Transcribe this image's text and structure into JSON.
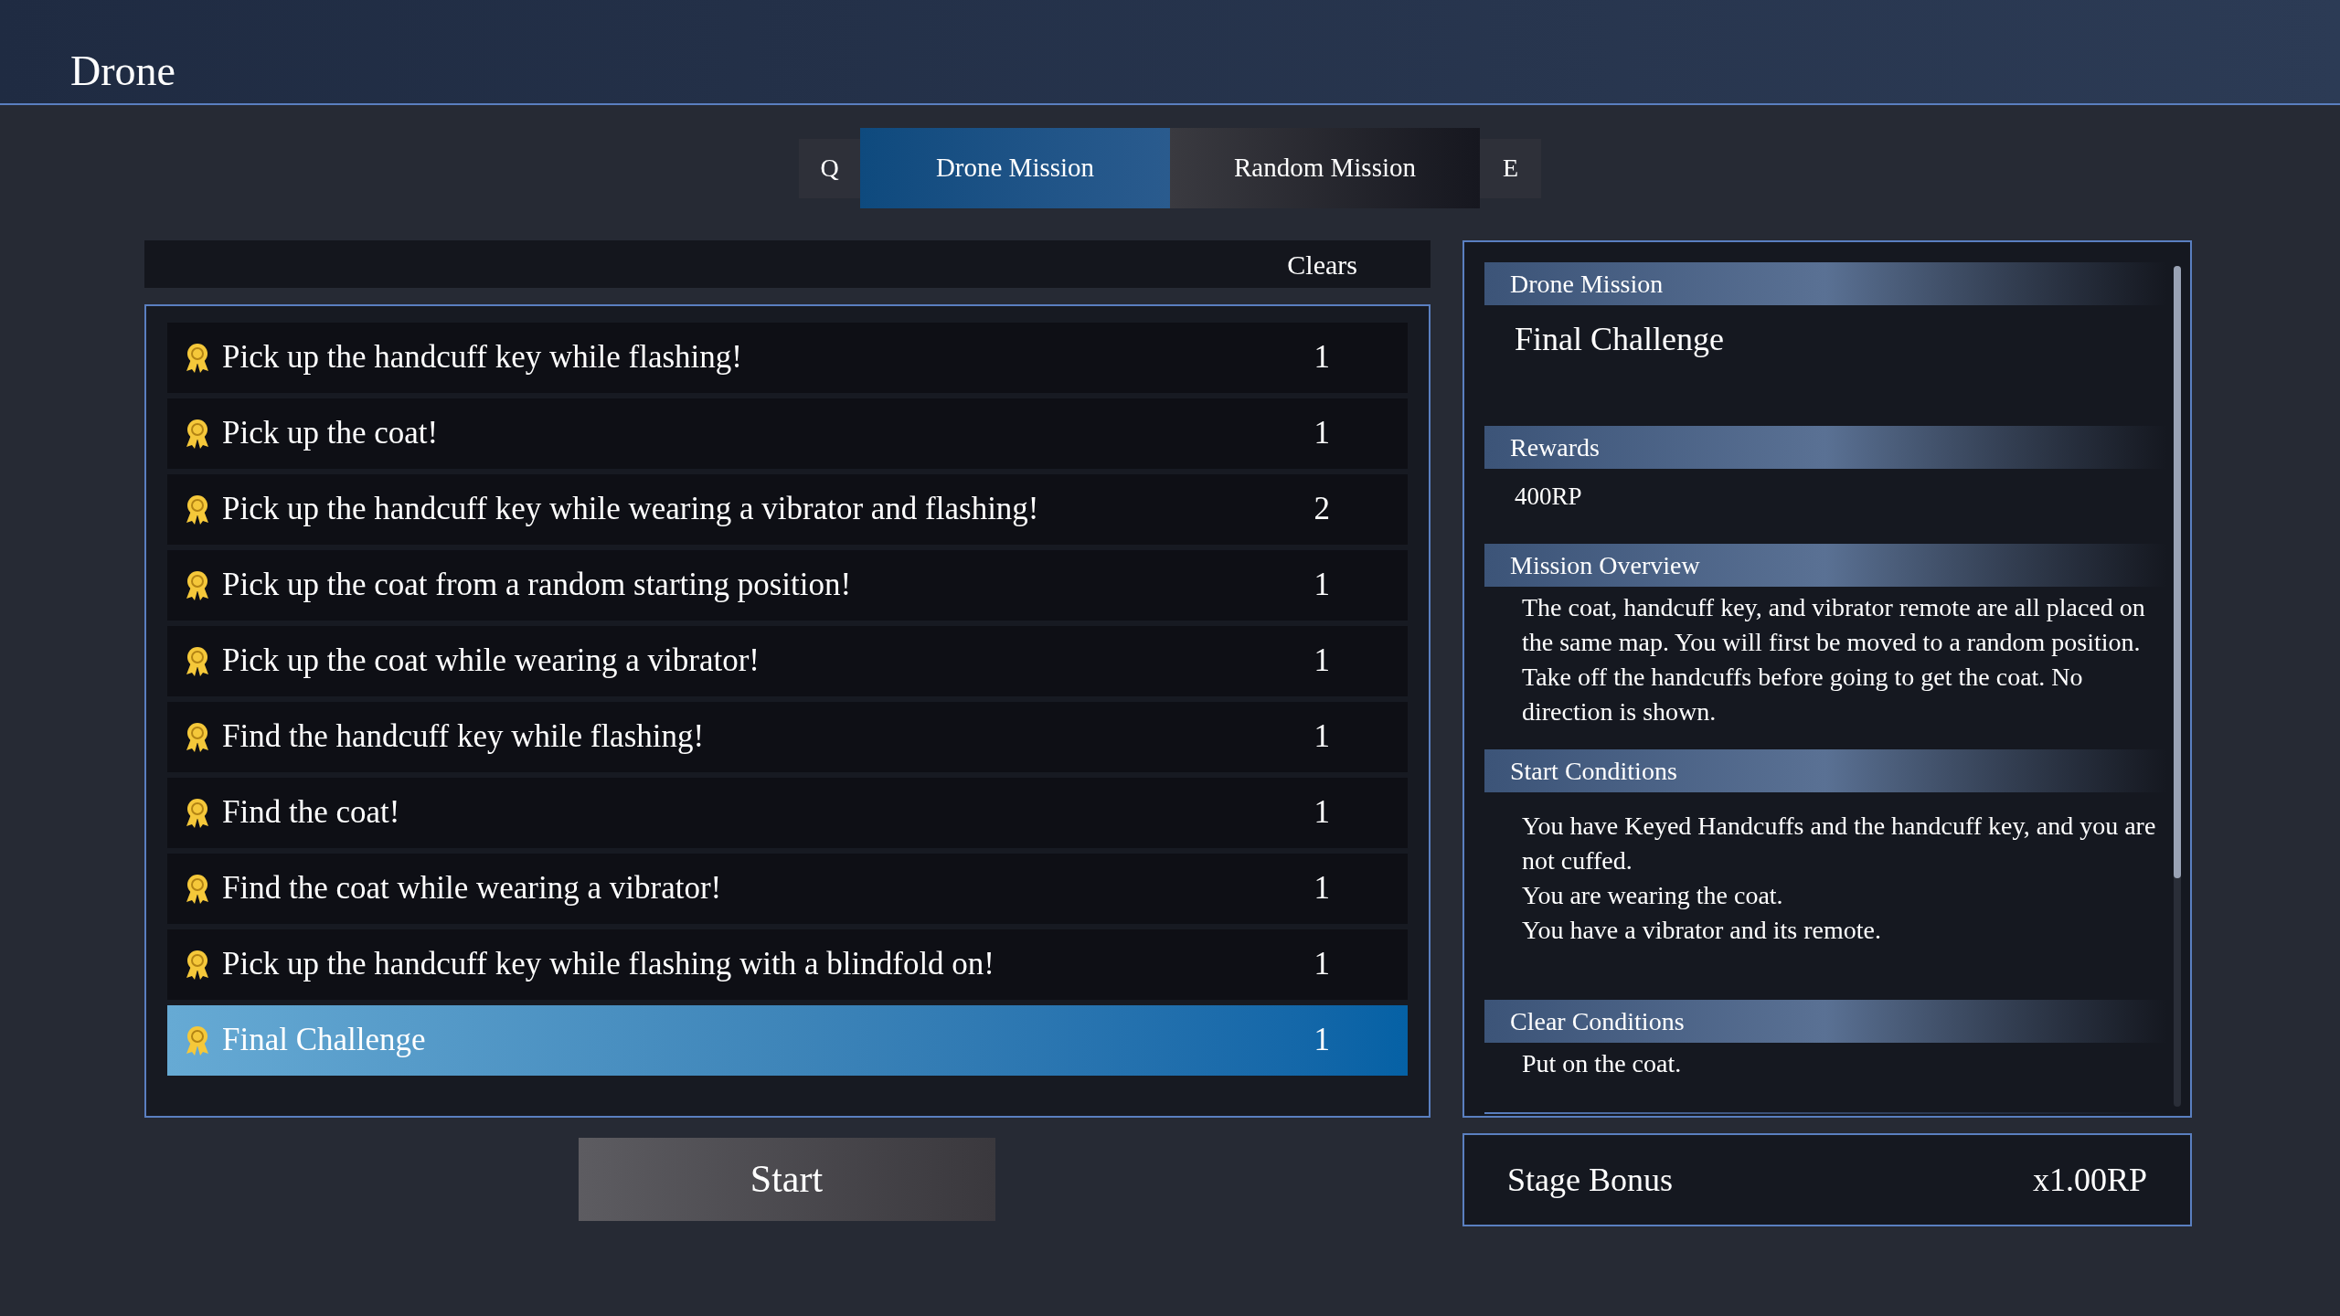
{
  "header": {
    "title": "Drone"
  },
  "tabs": [
    {
      "label": "Q",
      "kind": "key",
      "selected": false
    },
    {
      "label": "Drone Mission",
      "kind": "tab",
      "selected": true
    },
    {
      "label": "Random Mission",
      "kind": "tab",
      "selected": false
    },
    {
      "label": "E",
      "kind": "key",
      "selected": false
    }
  ],
  "missions": {
    "columns": [
      "Clears"
    ],
    "rows": [
      {
        "name": "Pick up the handcuff key while flashing!",
        "clears": "1",
        "selected": false
      },
      {
        "name": "Pick up the coat!",
        "clears": "1",
        "selected": false
      },
      {
        "name": "Pick up the handcuff key while wearing a vibrator and flashing!",
        "clears": "2",
        "selected": false
      },
      {
        "name": "Pick up the coat from a random starting position!",
        "clears": "1",
        "selected": false
      },
      {
        "name": "Pick up the coat while wearing a vibrator!",
        "clears": "1",
        "selected": false
      },
      {
        "name": "Find the handcuff key while flashing!",
        "clears": "1",
        "selected": false
      },
      {
        "name": "Find the coat!",
        "clears": "1",
        "selected": false
      },
      {
        "name": "Find the coat while wearing a vibrator!",
        "clears": "1",
        "selected": false
      },
      {
        "name": "Pick up the handcuff key while flashing with a blindfold on!",
        "clears": "1",
        "selected": false
      },
      {
        "name": "Final Challenge",
        "clears": "1",
        "selected": true
      }
    ]
  },
  "start_button": "Start",
  "details": {
    "sections": [
      {
        "heading": "Drone Mission",
        "kind": "title",
        "lines": [
          "Final Challenge"
        ]
      },
      {
        "heading": "Rewards",
        "kind": "value",
        "lines": [
          "400RP"
        ]
      },
      {
        "heading": "Mission Overview",
        "kind": "text",
        "lines": [
          "The coat, handcuff key, and vibrator remote are all placed on the same map. You will first be moved to a random position. Take off the handcuffs before going to get the coat. No direction is shown."
        ]
      },
      {
        "heading": "Start Conditions",
        "kind": "text",
        "lines": [
          "You have Keyed Handcuffs and the handcuff key, and you are not cuffed.",
          "You are wearing the coat.",
          "You have a vibrator and its remote."
        ]
      },
      {
        "heading": "Clear Conditions",
        "kind": "text",
        "lines": [
          "Put on the coat."
        ]
      }
    ]
  },
  "stage_bonus": {
    "label": "Stage Bonus",
    "value": "x1.00RP"
  }
}
